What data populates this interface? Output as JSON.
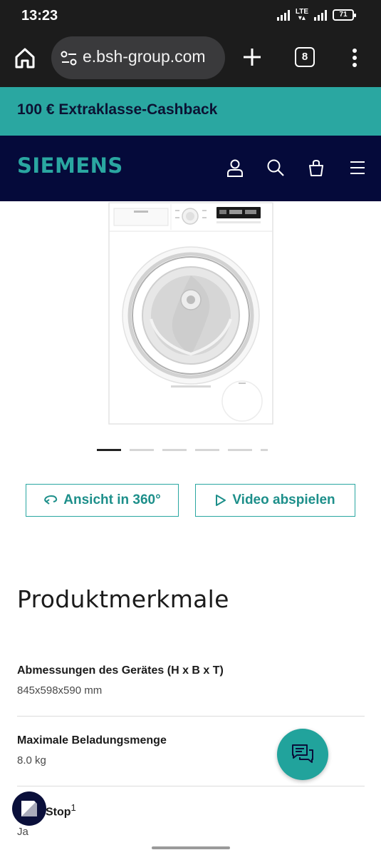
{
  "status_bar": {
    "time": "13:23",
    "network": "LTE",
    "battery": "71"
  },
  "browser": {
    "url": "e.bsh-group.com",
    "tab_count": "8",
    "icons": [
      "home-icon",
      "site-settings-icon",
      "plus-icon",
      "tabs-icon",
      "more-vert-icon"
    ]
  },
  "promo_banner": {
    "text": "100 € Extraklasse-Cashback"
  },
  "header": {
    "logo": "SIEMENS",
    "icons": [
      "user-icon",
      "search-icon",
      "basket-icon",
      "menu-icon"
    ]
  },
  "carousel": {
    "slide_count": 6,
    "active_index": 0
  },
  "actions": {
    "view360_label": "Ansicht in 360°",
    "video_label": "Video abspielen"
  },
  "product_features": {
    "title": "Produktmerkmale",
    "items": [
      {
        "label": "Abmessungen des Gerätes (H x B x T)",
        "value": "845x598x590 mm"
      },
      {
        "label": "Maximale Beladungsmenge",
        "value": "8.0 kg"
      },
      {
        "label": "Stop",
        "superscript": "1",
        "value": "Ja"
      }
    ]
  },
  "colors": {
    "accent": "#2aa7a1",
    "header_bg": "#050a3a",
    "browser_bg": "#1c1c1c"
  }
}
